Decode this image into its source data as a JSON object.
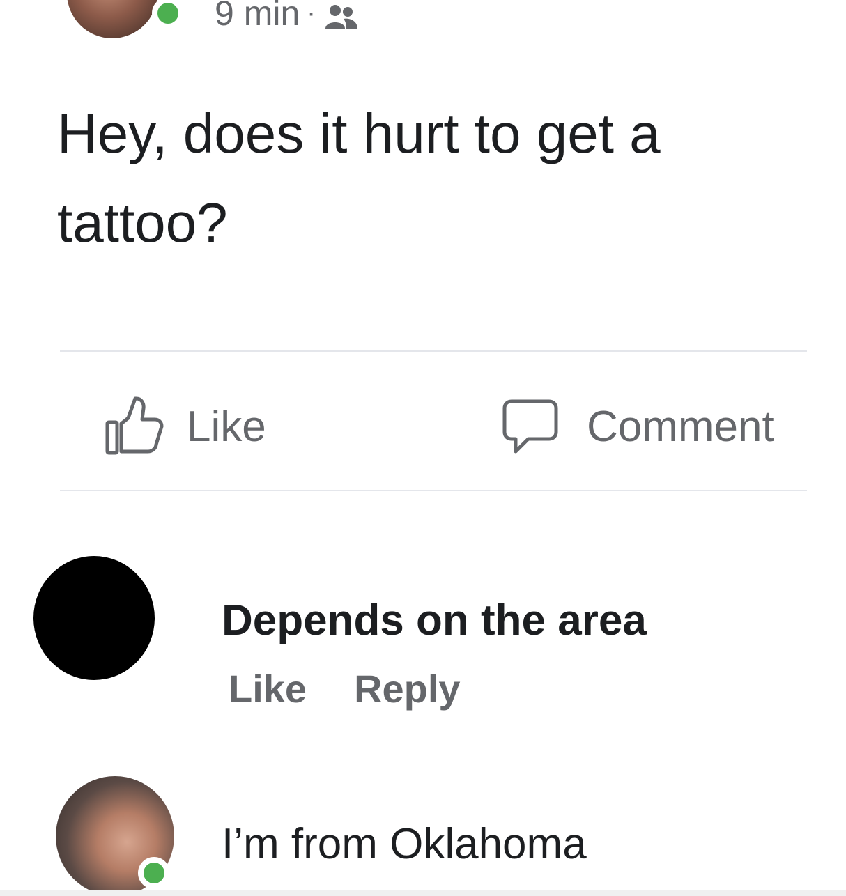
{
  "post": {
    "timestamp": "9 min",
    "separator": "·",
    "audience_icon": "friends-icon",
    "text": "Hey, does it hurt to get a tattoo?",
    "online_status_color": "#4caf50"
  },
  "actions": {
    "like_label": "Like",
    "comment_label": "Comment"
  },
  "comments": [
    {
      "text": "Depends on the area",
      "like_label": "Like",
      "reply_label": "Reply",
      "avatar": "black-circle"
    },
    {
      "text": "I’m from Oklahoma",
      "avatar": "photo",
      "online": true
    }
  ],
  "colors": {
    "primary_text": "#1c1e21",
    "secondary_text": "#65676b",
    "divider": "#e4e6eb",
    "online_green": "#4caf50"
  }
}
